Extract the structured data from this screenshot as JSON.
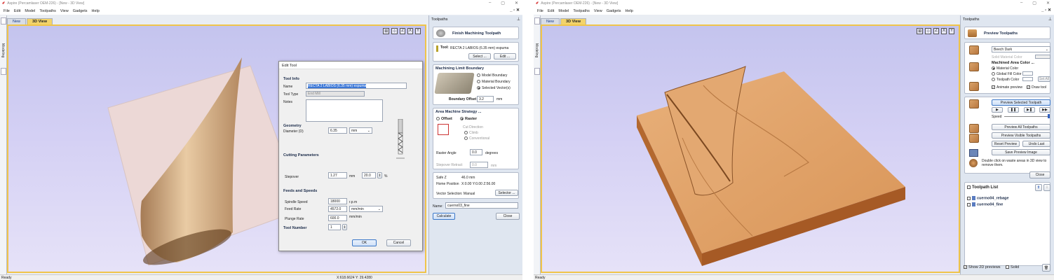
{
  "left": {
    "title": "Aspire (Percamlaser OEM-226) - [New - 3D View]",
    "menu": [
      "File",
      "Edit",
      "Model",
      "Toolpaths",
      "View",
      "Gadgets",
      "Help"
    ],
    "tabs": [
      "New",
      "3D View"
    ],
    "side_label": "Modeling",
    "status": "Ready",
    "coords": "X:618.6624 Y: 29.4280",
    "panel": {
      "header": "Toolpaths",
      "title": "Finish Machining Toolpath",
      "tool_label": "Tool:",
      "tool_value": "RECTA 2 LABIOS (6.35 mm) espuma",
      "select_btn": "Select ...",
      "edit_btn": "Edit ...",
      "mlb_title": "Machining Limit Boundary",
      "mlb_options": [
        "Model Boundary",
        "Material Boundary",
        "Selected Vector(s)"
      ],
      "boundary_offset_label": "Boundary Offset",
      "boundary_offset_value": "3.2",
      "boundary_offset_unit": "mm",
      "ams_title": "Area Machine Strategy ...",
      "offset": "Offset",
      "raster": "Raster",
      "cut_direction": "Cut Direction",
      "climb": "Climb",
      "conventional": "Conventional",
      "raster_angle_label": "Raster Angle",
      "raster_angle_value": "0.0",
      "raster_angle_unit": "degrees",
      "stepover_retract_label": "Stepover Retract",
      "stepover_retract_value": "0.0",
      "stepover_retract_unit": "mm",
      "safe_z_label": "Safe Z",
      "safe_z_value": "46.0 mm",
      "home_label": "Home Position",
      "home_value": "X:0.00 Y:0.00 Z:56.00",
      "vector_selection": "Vector Selection:  Manual",
      "selector_btn": "Selector ...",
      "name_label": "Name:",
      "name_value": "cuerno03_fine",
      "calculate": "Calculate",
      "close": "Close"
    },
    "dialog": {
      "title": "Edit Tool",
      "tool_info": "Tool Info",
      "name_label": "Name",
      "name_value": "RECTA 2 LABIOS (6.35 mm) espuma",
      "tool_type_label": "Tool Type",
      "tool_type_value": "End Mill",
      "notes_label": "Notes",
      "geometry": "Geometry",
      "diameter_label": "Diameter (D)",
      "diameter_value": "6.35",
      "diameter_unit": "mm",
      "cutting_params": "Cutting Parameters",
      "stepover_label": "Stepover",
      "stepover_value": "1.27",
      "stepover_unit": "mm",
      "stepover_pct": "20.0",
      "pct": "%",
      "feeds": "Feeds and Speeds",
      "spindle_label": "Spindle Speed",
      "spindle_value": "18000",
      "spindle_unit": "r.p.m",
      "feed_label": "Feed Rate",
      "feed_value": "4572.0",
      "feed_unit": "mm/min",
      "plunge_label": "Plunge Rate",
      "plunge_value": "600.0",
      "plunge_unit": "mm/min",
      "tool_number": "Tool Number",
      "tool_number_value": "1",
      "ok": "OK",
      "cancel": "Cancel"
    }
  },
  "right": {
    "title": "Aspire (Percamlaser OEM-226) - [New - 3D View]",
    "menu": [
      "File",
      "Edit",
      "Model",
      "Toolpaths",
      "View",
      "Gadgets",
      "Help"
    ],
    "tabs": [
      "New",
      "3D View"
    ],
    "side_label": "Modeling",
    "status": "Ready",
    "panel": {
      "header": "Toolpaths",
      "title": "Preview Toolpaths",
      "material": "Beech Dark",
      "solid_color": "Solid Material Color",
      "machined_title": "Machined Area Color ...",
      "material_color": "Material Color",
      "global_fill": "Global Fill Color",
      "toolpath_color": "Toolpath Color",
      "set_all": "Set All",
      "animate": "Animate preview",
      "draw_tool": "Draw tool",
      "preview_selected": "Preview Selected Toolpath",
      "speed": "Speed",
      "preview_all": "Preview All Toolpaths",
      "preview_visible": "Preview Visible Toolpaths",
      "reset_preview": "Reset Preview",
      "undo_last": "Undo Last",
      "save_image": "Save Preview Image",
      "hint": "Double click on waste areas in 3D view to remove them.",
      "close": "Close",
      "list_title": "Toolpath List",
      "items": [
        "cuerno04_rebage",
        "cuerno04_fine"
      ],
      "show_2d": "Show 2D previews",
      "solid": "Solid"
    }
  }
}
